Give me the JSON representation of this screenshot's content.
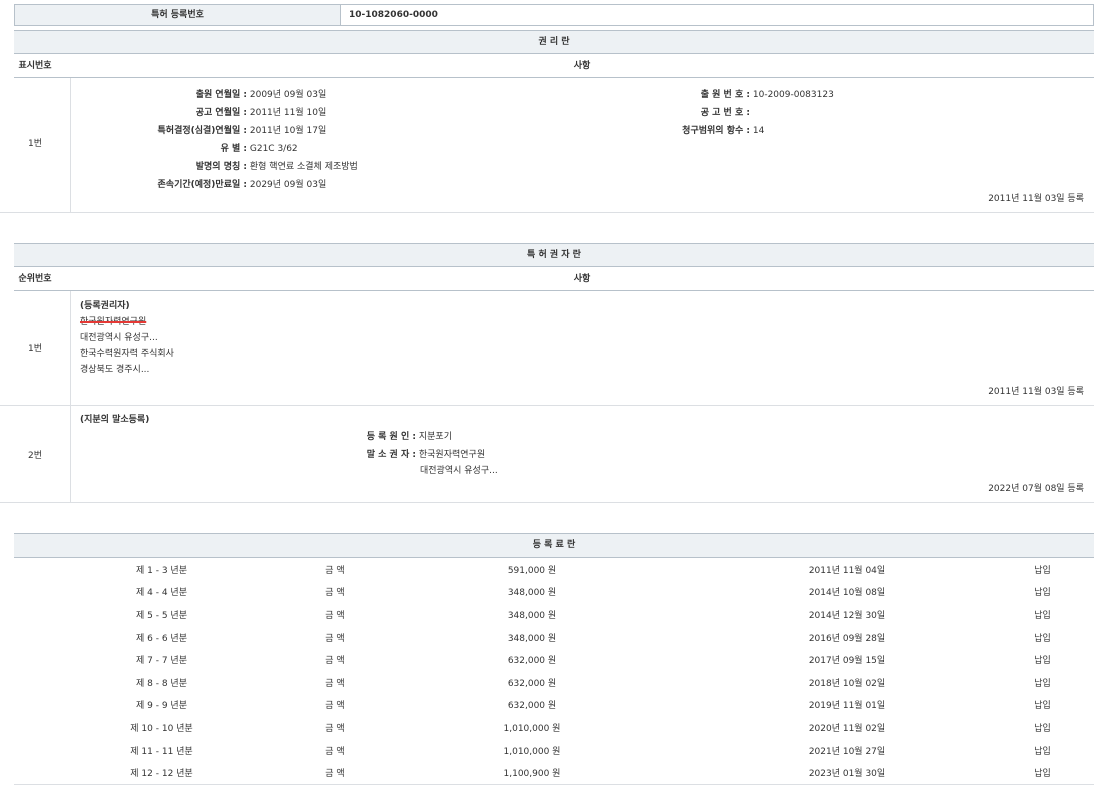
{
  "registration": {
    "label": "특허 등록번호",
    "value": "10-1082060-0000"
  },
  "rights_section": {
    "title": "권 리 란",
    "col_no": "표시번호",
    "col_matter": "사항",
    "row_no": "1번",
    "left_fields": [
      {
        "label": "출원 연월일 :",
        "value": "2009년 09월 03일"
      },
      {
        "label": "공고 연월일 :",
        "value": "2011년 11월 10일"
      },
      {
        "label": "특허결정(심결)연월일 :",
        "value": "2011년 10월 17일"
      },
      {
        "label": "유 별 :",
        "value": "G21C 3/62"
      },
      {
        "label": "발명의 명칭 :",
        "value": "환형 핵연료 소결체 제조방법"
      },
      {
        "label": "존속기간(예정)만료일 :",
        "value": "2029년 09월 03일"
      }
    ],
    "right_fields": [
      {
        "label": "출 원 번 호 :",
        "value": "10-2009-0083123"
      },
      {
        "label": "공 고 번 호 :",
        "value": ""
      },
      {
        "label": "청구범위의 항수 :",
        "value": "14"
      }
    ],
    "registered": "2011년 11월 03일 등록"
  },
  "owners_section": {
    "title": "특 허 권 자 란",
    "col_no": "순위번호",
    "col_matter": "사항",
    "row1": {
      "no": "1번",
      "heading": "(등록권리자)",
      "struck_name": "한국원자력연구원",
      "lines": [
        "대전광역시 유성구...",
        "한국수력원자력 주식회사",
        "경상북도 경주시..."
      ],
      "registered": "2011년 11월 03일 등록"
    },
    "row2": {
      "no": "2번",
      "heading": "(지분의 말소등록)",
      "cause_label": "등 록 원 인 :",
      "cause_value": "지분포기",
      "cancel_label": "말 소 권 자 :",
      "cancel_value": "한국원자력연구원",
      "cancel_addr": "대전광역시 유성구...",
      "registered": "2022년 07월 08일 등록"
    }
  },
  "fees_section": {
    "title": "등 록 료 란",
    "rows": [
      {
        "period": "제 1 - 3 년분",
        "label": "금 액",
        "amount": "591,000 원",
        "date": "2011년 11월 04일",
        "status": "납입"
      },
      {
        "period": "제 4 - 4 년분",
        "label": "금 액",
        "amount": "348,000 원",
        "date": "2014년 10월 08일",
        "status": "납입"
      },
      {
        "period": "제 5 - 5 년분",
        "label": "금 액",
        "amount": "348,000 원",
        "date": "2014년 12월 30일",
        "status": "납입"
      },
      {
        "period": "제 6 - 6 년분",
        "label": "금 액",
        "amount": "348,000 원",
        "date": "2016년 09월 28일",
        "status": "납입"
      },
      {
        "period": "제 7 - 7 년분",
        "label": "금 액",
        "amount": "632,000 원",
        "date": "2017년 09월 15일",
        "status": "납입"
      },
      {
        "period": "제 8 - 8 년분",
        "label": "금 액",
        "amount": "632,000 원",
        "date": "2018년 10월 02일",
        "status": "납입"
      },
      {
        "period": "제 9 - 9 년분",
        "label": "금 액",
        "amount": "632,000 원",
        "date": "2019년 11월 01일",
        "status": "납입"
      },
      {
        "period": "제 10 - 10 년분",
        "label": "금 액",
        "amount": "1,010,000 원",
        "date": "2020년 11월 02일",
        "status": "납입"
      },
      {
        "period": "제 11 - 11 년분",
        "label": "금 액",
        "amount": "1,010,000 원",
        "date": "2021년 10월 27일",
        "status": "납입"
      },
      {
        "period": "제 12 - 12 년분",
        "label": "금 액",
        "amount": "1,100,900 원",
        "date": "2023년 01월 30일",
        "status": "납입"
      }
    ]
  }
}
